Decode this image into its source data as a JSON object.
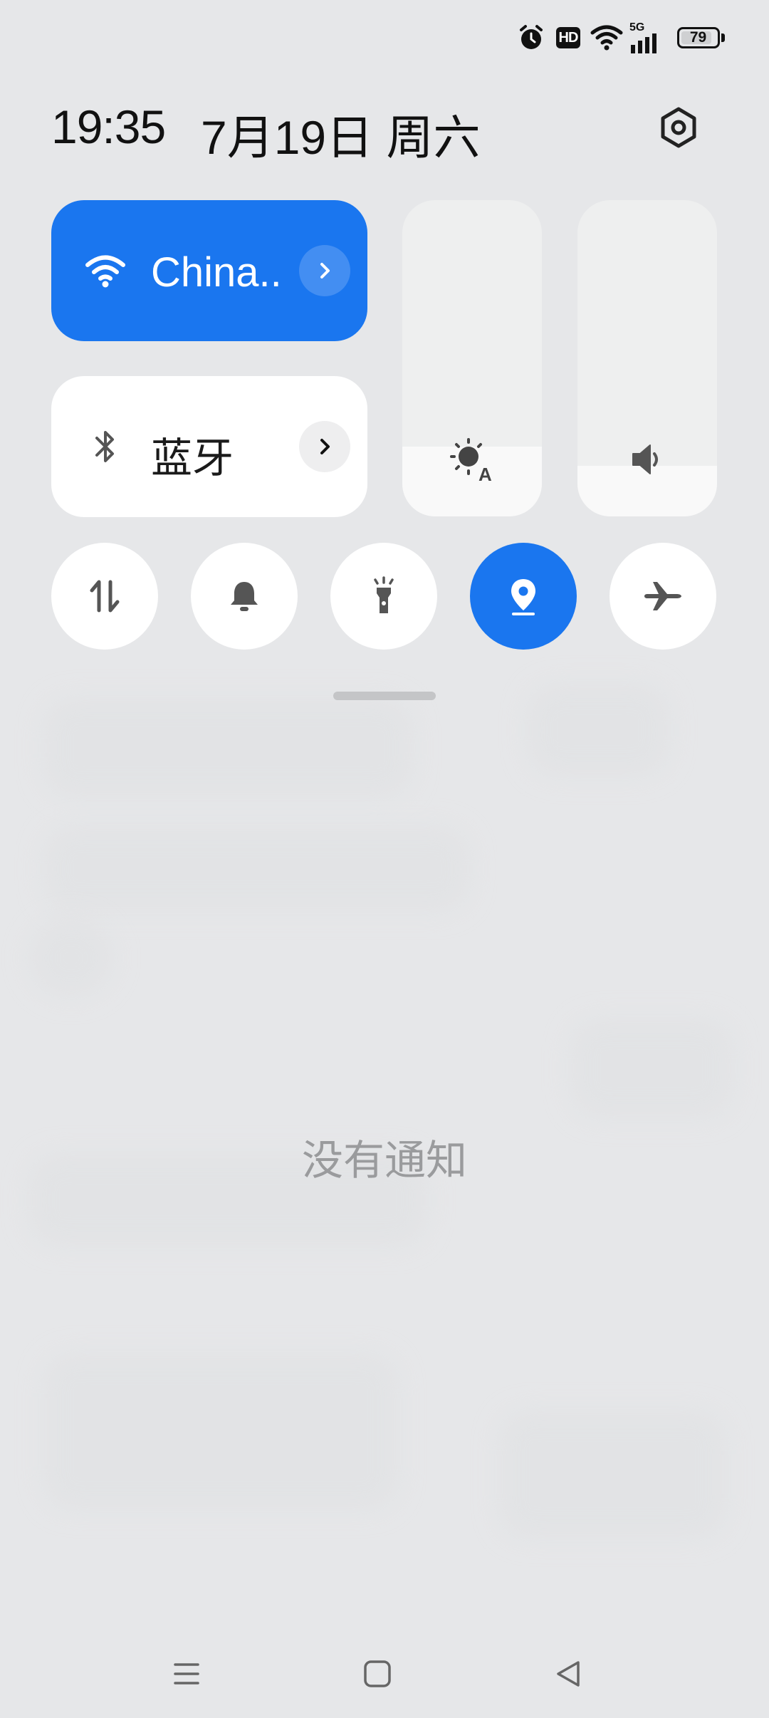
{
  "status_bar": {
    "icons": [
      "alarm-icon",
      "hd-icon",
      "wifi-icon",
      "5g-signal-icon",
      "battery-icon"
    ],
    "hd_label": "HD",
    "network_label": "5G",
    "battery_level": "79"
  },
  "header": {
    "time": "19:35",
    "date": "7月19日 周六",
    "settings_icon": "gear-icon"
  },
  "tiles": {
    "wifi": {
      "label": "China..",
      "active": true,
      "icon": "wifi-icon",
      "arrow_icon": "chevron-right-icon"
    },
    "bluetooth": {
      "label": "蓝牙",
      "active": false,
      "icon": "bluetooth-icon",
      "arrow_icon": "chevron-right-icon"
    }
  },
  "sliders": {
    "brightness": {
      "icon": "auto-brightness-icon",
      "level": 0.22
    },
    "volume": {
      "icon": "speaker-icon",
      "level": 0.16
    }
  },
  "toggles": [
    {
      "name": "mobile-data",
      "icon": "data-transfer-icon",
      "active": false
    },
    {
      "name": "ringer",
      "icon": "bell-icon",
      "active": false
    },
    {
      "name": "flashlight",
      "icon": "flashlight-icon",
      "active": false
    },
    {
      "name": "location",
      "icon": "location-pin-icon",
      "active": true
    },
    {
      "name": "airplane-mode",
      "icon": "airplane-icon",
      "active": false
    }
  ],
  "notifications": {
    "empty_text": "没有通知"
  },
  "nav_bar": {
    "buttons": [
      "menu-icon",
      "home-icon",
      "back-icon"
    ]
  },
  "colors": {
    "accent": "#1a76ef",
    "background": "#e6e7e9",
    "tile_inactive": "#ffffff"
  }
}
